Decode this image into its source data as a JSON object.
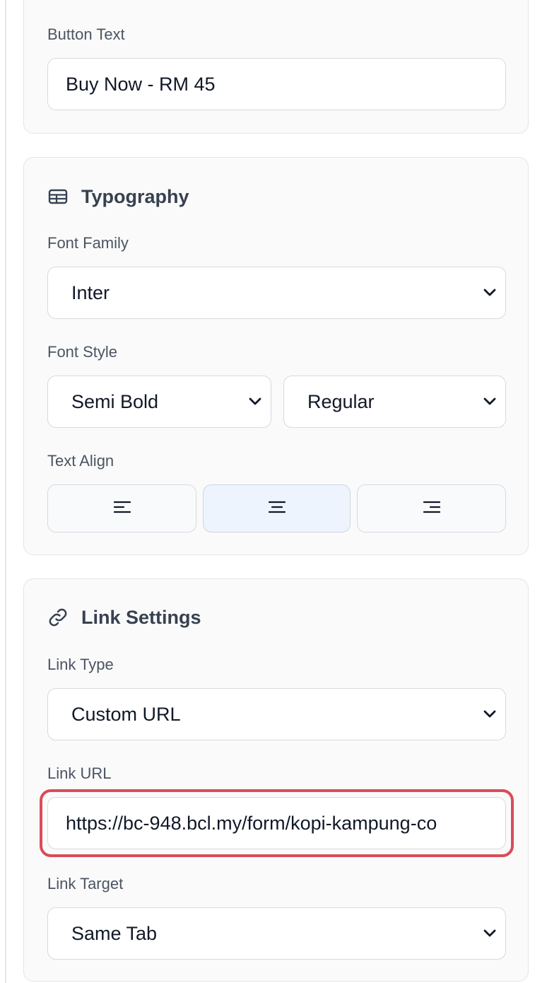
{
  "button_section": {
    "button_text_label": "Button Text",
    "button_text_value": "Buy Now - RM 45"
  },
  "typography": {
    "title": "Typography",
    "font_family_label": "Font Family",
    "font_family_value": "Inter",
    "font_style_label": "Font Style",
    "font_weight_value": "Semi Bold",
    "font_variant_value": "Regular",
    "text_align_label": "Text Align",
    "align_options": [
      "left",
      "center",
      "right"
    ],
    "align_selected": "center"
  },
  "link_settings": {
    "title": "Link Settings",
    "link_type_label": "Link Type",
    "link_type_value": "Custom URL",
    "link_url_label": "Link URL",
    "link_url_value": "https://bc-948.bcl.my/form/kopi-kampung-co",
    "link_target_label": "Link Target",
    "link_target_value": "Same Tab"
  },
  "colors": {
    "accent_highlight": "#d94c57",
    "active_align_bg": "#edf4fe"
  },
  "icons": {
    "typography": "table-icon",
    "link": "link-icon",
    "select": "chevron-down-icon"
  }
}
